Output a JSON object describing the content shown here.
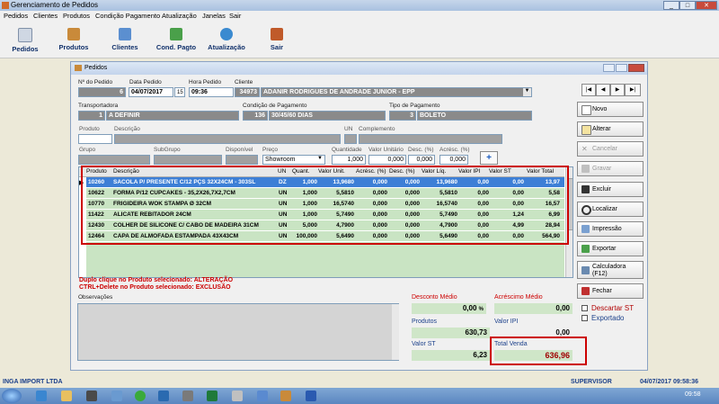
{
  "app": {
    "title": "Gerenciamento de Pedidos"
  },
  "menu": [
    "Pedidos",
    "Clientes",
    "Produtos",
    "Condição Pagamento",
    "Atualização",
    "Janelas",
    "Sair"
  ],
  "toolbar": [
    {
      "label": "Pedidos",
      "icon": "orders-icon",
      "color": "#cfd7e3"
    },
    {
      "label": "Produtos",
      "icon": "box-icon",
      "color": "#c98a3a"
    },
    {
      "label": "Clientes",
      "icon": "people-icon",
      "color": "#5b8fd0"
    },
    {
      "label": "Cond. Pagto",
      "icon": "payment-icon",
      "color": "#4aa04a"
    },
    {
      "label": "Atualização",
      "icon": "globe-icon",
      "color": "#3a8ad0"
    },
    {
      "label": "Sair",
      "icon": "exit-door-icon",
      "color": "#c05a2a"
    }
  ],
  "window": {
    "title": "Pedidos"
  },
  "form": {
    "num_pedido_label": "Nº do Pedido",
    "num_pedido": "6",
    "data_label": "Data Pedido",
    "data": "04/07/2017",
    "cal_btn": "15",
    "hora_label": "Hora Pedido",
    "hora": "09:36",
    "cliente_label": "Cliente",
    "cliente_code": "34973",
    "cliente_name": "ADANIR RODRIGUES DE ANDRADE JUNIOR - EPP",
    "transp_label": "Transportadora",
    "transp_code": "1",
    "transp_name": "A DEFINIR",
    "cond_label": "Condição de Pagamento",
    "cond_code": "136",
    "cond_name": "30/45/60 DIAS",
    "tipo_label": "Tipo de Pagamento",
    "tipo_code": "3",
    "tipo_name": "BOLETO",
    "produto_label": "Produto",
    "descricao_label": "Descrição",
    "un_label": "UN",
    "complemento_label": "Complemento",
    "grupo_label": "Grupo",
    "subgrupo_label": "SubGrupo",
    "disponivel_label": "Disponível",
    "preco_label": "Preço",
    "preco_value": "Showroom",
    "quantidade_label": "Quantidade",
    "quantidade": "1,000",
    "valor_unit_label": "Valor Unitário",
    "valor_unit": "0,000",
    "desc_label": "Desc. (%)",
    "desc": "0,000",
    "acresc_label": "Acrésc. (%)",
    "acresc": "0,000",
    "add_btn": "+"
  },
  "grid": {
    "headers": [
      "Produto",
      "Descrição",
      "UN",
      "Quant.",
      "Valor Unit.",
      "Acrésc. (%)",
      "Desc. (%)",
      "Valor Líq.",
      "Valor IPI",
      "Valor ST",
      "Valor Total"
    ],
    "rows": [
      [
        "10260",
        "SACOLA P/ PRESENTE C/12 PÇS 32X24CM - 303SL",
        "DZ",
        "1,000",
        "13,9680",
        "0,000",
        "0,000",
        "13,9680",
        "0,00",
        "0,00",
        "13,97"
      ],
      [
        "10622",
        "FORMA P/12 CUPCAKES - 35,2X26,7X2,7CM",
        "UN",
        "1,000",
        "5,5810",
        "0,000",
        "0,000",
        "5,5810",
        "0,00",
        "0,00",
        "5,58"
      ],
      [
        "10770",
        "FRIGIDEIRA WOK STAMPA Ø 32CM",
        "UN",
        "1,000",
        "16,5740",
        "0,000",
        "0,000",
        "16,5740",
        "0,00",
        "0,00",
        "16,57"
      ],
      [
        "11422",
        "ALICATE REBITADOR 24CM",
        "UN",
        "1,000",
        "5,7490",
        "0,000",
        "0,000",
        "5,7490",
        "0,00",
        "1,24",
        "6,99"
      ],
      [
        "12430",
        "COLHER DE SILICONE C/ CABO DE MADEIRA 31CM",
        "UN",
        "5,000",
        "4,7900",
        "0,000",
        "0,000",
        "4,7900",
        "0,00",
        "4,99",
        "28,94"
      ],
      [
        "12464",
        "CAPA DE ALMOFADA ESTAMPADA 43X43CM",
        "UN",
        "100,000",
        "5,6490",
        "0,000",
        "0,000",
        "5,6490",
        "0,00",
        "0,00",
        "564,90"
      ]
    ]
  },
  "hints": {
    "line1": "Duplo clique no Produto selecionado: ALTERAÇÃO",
    "line2": "CTRL+Delete no Produto selecionado: EXCLUSÃO"
  },
  "obs_label": "Observações",
  "totals": {
    "desconto_label": "Desconto Médio",
    "desconto": "0,00",
    "desconto_unit": "%",
    "acrescimo_label": "Acréscimo Médio",
    "acrescimo": "0,00",
    "produtos_label": "Produtos",
    "produtos": "630,73",
    "ipi_label": "Valor IPI",
    "ipi": "0,00",
    "st_label": "Valor ST",
    "st": "6,23",
    "total_label": "Total Venda",
    "total": "636,96"
  },
  "buttons": {
    "nav": [
      "|◀",
      "◀",
      "▶",
      "▶|"
    ],
    "novo": "Novo",
    "alterar": "Alterar",
    "cancelar": "Cancelar",
    "gravar": "Gravar",
    "excluir": "Excluir",
    "localizar": "Localizar",
    "impressao": "Impressão",
    "exportar": "Exportar",
    "calculadora": "Calculadora (F12)",
    "fechar": "Fechar"
  },
  "checks": {
    "descartar": "Descartar ST",
    "exportado": "Exportado"
  },
  "status": {
    "company": "INGA IMPORT LTDA",
    "user": "SUPERVISOR",
    "datetime": "04/07/2017 09:58:36"
  },
  "taskbar": {
    "clock": "09:58"
  },
  "colors": {
    "accent": "#cc0000",
    "row_green": "#c9e4c3",
    "selected": "#3d7fd6"
  }
}
